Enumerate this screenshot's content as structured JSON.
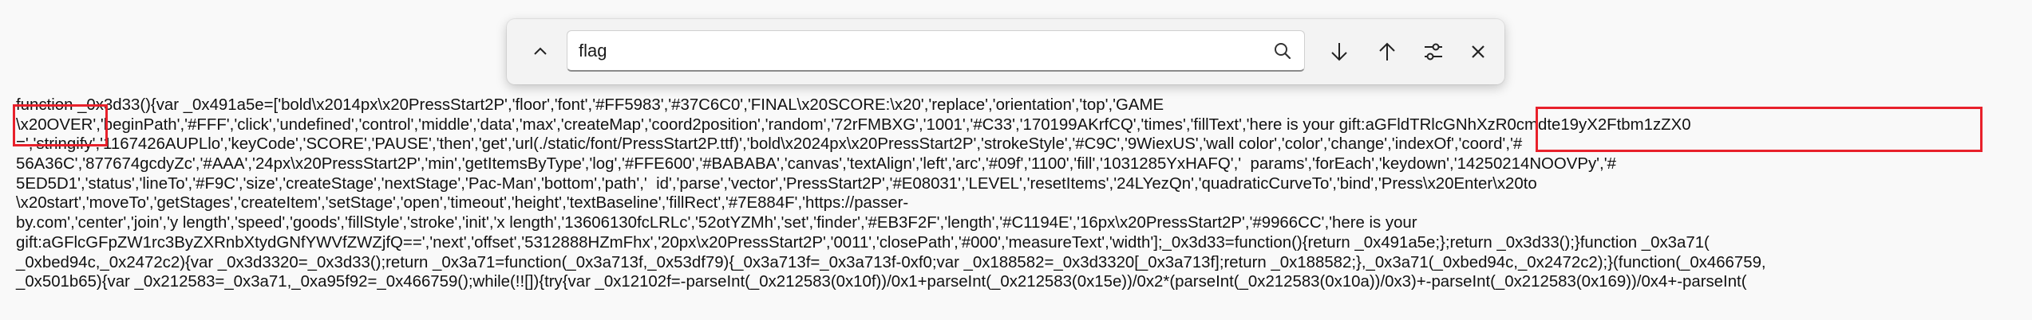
{
  "find_bar": {
    "query": "flag",
    "previous_label": "Previous match",
    "next_label": "Next match",
    "options_label": "Find options",
    "close_label": "Close find bar"
  },
  "colors": {
    "annotation": "#e8212b",
    "page_background": "#f9f9f9"
  },
  "code_lines": [
    "function _0x3d33(){var _0x491a5e=['bold\\x2014px\\x20PressStart2P','floor','font','#FF5983','#37C6C0','FINAL\\x20SCORE:\\x20','replace','orientation','top','GAME",
    "\\x20OVER','beginPath','#FFF','click','undefined','control','middle','data','max','createMap','coord2position','random','72rFMBXG','1001','#C33','170199AKrfCQ','times','fillText','here is your gift:aGFldTRlcGNhXzR0cmdte19yX2Ftbm1zZX0",
    "=','stringify','1167426AUPLlo','keyCode','SCORE','PAUSE','then','get','url(./static/font/PressStart2P.ttf)','bold\\x2024px\\x20PressStart2P','strokeStyle','#C9C','9WiexUS','wall color','color','change','indexOf','coord','#",
    "56A36C','877674gcdyZc','#AAA','24px\\x20PressStart2P','min','getItemsByType','log','#FFE600','#BABABA','canvas','textAlign','left','arc','#09f','1100','fill','1031285YxHAFQ','  params','forEach','keydown','14250214NOOVPy','#",
    "5ED5D1','status','lineTo','#F9C','size','createStage','nextStage','Pac-Man','bottom','path','  id','parse','vector','PressStart2P','#E08031','LEVEL','resetItems','24LYezQn','quadraticCurveTo','bind','Press\\x20Enter\\x20to",
    "\\x20start','moveTo','getStages','createItem','setStage','open','timeout','height','textBaseline','fillRect','#7E884F','https://passer-",
    "by.com','center','join','y length','speed','goods','fillStyle','stroke','init','x length','13606130fcLRLc','52otYZMh','set','finder','#EB3F2F','length','#C1194E','16px\\x20PressStart2P','#9966CC','here is your",
    "gift:aGFlcGFpZW1rc3ByZXRnbXtydGNfYWVfZWZjfQ==','next','offset','5312888HZmFhx','20px\\x20PressStart2P','0011','closePath','#000','measureText','width'];_0x3d33=function(){return _0x491a5e;};return _0x3d33();}function _0x3a71(",
    "_0xbed94c,_0x2472c2){var _0x3d3320=_0x3d33();return _0x3a71=function(_0x3a713f,_0x53df79){_0x3a713f=_0x3a713f-0xf0;var _0x188582=_0x3d3320[_0x3a713f];return _0x188582;},_0x3a71(_0xbed94c,_0x2472c2);}(function(_0x466759,",
    "_0x501b65){var _0x212583=_0x3a71,_0xa95f92=_0x466759();while(!![]){try{var _0x12102f=-parseInt(_0x212583(0x10f))/0x1+parseInt(_0x212583(0x15e))/0x2*(parseInt(_0x212583(0x10a))/0x3)+-parseInt(_0x212583(0x169))/0x4+-parseInt("
  ]
}
